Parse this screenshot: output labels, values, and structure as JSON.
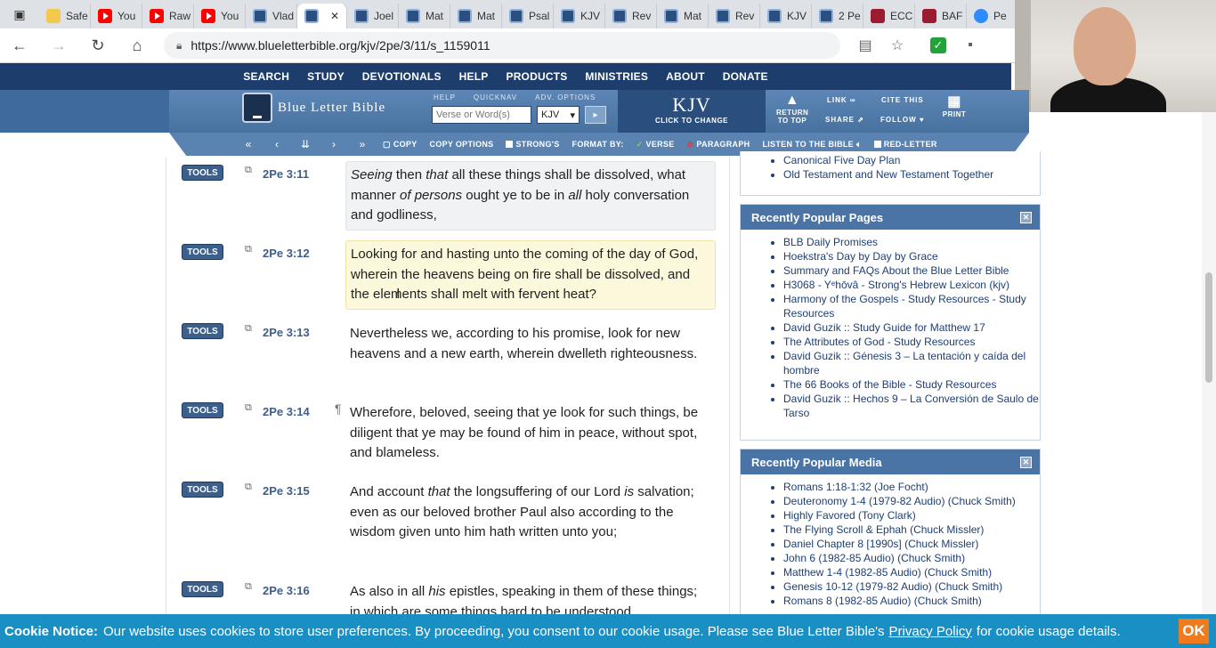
{
  "browser": {
    "tabs": [
      {
        "icon": "check-icon",
        "label": "Safe"
      },
      {
        "icon": "youtube-icon",
        "label": "You"
      },
      {
        "icon": "youtube-icon",
        "label": "Raw"
      },
      {
        "icon": "youtube-icon",
        "label": "You"
      },
      {
        "icon": "blb-icon",
        "label": "Vlad"
      },
      {
        "icon": "blb-icon",
        "label": "",
        "active": true
      },
      {
        "icon": "blb-icon",
        "label": "Joel"
      },
      {
        "icon": "blb-icon",
        "label": "Mat"
      },
      {
        "icon": "blb-icon",
        "label": "Mat"
      },
      {
        "icon": "blb-icon",
        "label": "Psal"
      },
      {
        "icon": "blb-icon",
        "label": "KJV"
      },
      {
        "icon": "blb-icon",
        "label": "Rev"
      },
      {
        "icon": "blb-icon",
        "label": "Mat"
      },
      {
        "icon": "blb-icon",
        "label": "Rev"
      },
      {
        "icon": "blb-icon",
        "label": "KJV"
      },
      {
        "icon": "blb-icon",
        "label": "2 Pe"
      },
      {
        "icon": "red-icon",
        "label": "ECC"
      },
      {
        "icon": "red-icon",
        "label": "BAF"
      },
      {
        "icon": "zoom-icon",
        "label": "Pe"
      }
    ],
    "url": "https://www.blueletterbible.org/kjv/2pe/3/11/s_1159011"
  },
  "site": {
    "topnav": [
      "SEARCH",
      "STUDY",
      "DEVOTIONALS",
      "HELP",
      "PRODUCTS",
      "MINISTRIES",
      "ABOUT",
      "DONATE"
    ],
    "logo_text": "Blue Letter Bible",
    "header_labels": [
      "HELP",
      "QUICKNAV",
      "ADV. OPTIONS"
    ],
    "search_placeholder": "Verse or Word(s)",
    "version": "KJV",
    "version_big": "KJV",
    "version_small": "CLICK TO CHANGE",
    "return_top": "RETURN TO TOP",
    "link": "LINK",
    "share": "SHARE",
    "cite": "CITE THIS",
    "follow": "FOLLOW",
    "print": "PRINT"
  },
  "subnav": {
    "copy": "COPY",
    "copy_options": "COPY OPTIONS",
    "strongs": "STRONG'S",
    "format_by": "FORMAT BY:",
    "verse": "VERSE",
    "paragraph": "PARAGRAPH",
    "listen": "LISTEN TO THE BIBLE",
    "red_letter": "RED-LETTER"
  },
  "verses": [
    {
      "tools": "TOOLS",
      "ref": "2Pe 3:11",
      "html": "<i>Seeing</i> then <i>that</i> all these things shall be dissolved, what manner <i>of persons</i> ought ye to be in <i>all</i> holy conversation and godliness,"
    },
    {
      "tools": "TOOLS",
      "ref": "2Pe 3:12",
      "html": "Looking for and hasting unto the coming of the day of God, wherein the heavens being on fire shall be dissolved, and the elements shall melt with fervent heat?"
    },
    {
      "tools": "TOOLS",
      "ref": "2Pe 3:13",
      "html": "Nevertheless we, according to his promise, look for new heavens and a new earth, wherein dwelleth righteousness."
    },
    {
      "tools": "TOOLS",
      "ref": "2Pe 3:14",
      "html": "Wherefore, beloved, seeing that ye look for such things, be diligent that ye may be found of him in peace, without spot, and blameless."
    },
    {
      "tools": "TOOLS",
      "ref": "2Pe 3:15",
      "html": "And account <i>that</i> the longsuffering of our Lord <i>is</i> salvation; even as our beloved brother Paul also according to the wisdom given unto him hath written unto you;"
    },
    {
      "tools": "TOOLS",
      "ref": "2Pe 3:16",
      "html": "As also in all <i>his</i> epistles, speaking in them of these things; in which are some things hard to be understood,"
    }
  ],
  "paragraph_mark": "¶",
  "sidebar": {
    "top_items": [
      "Canonical Five Day Plan",
      "Old Testament and New Testament Together"
    ],
    "popular_pages": {
      "title": "Recently Popular Pages",
      "items": [
        "BLB Daily Promises",
        "Hoekstra's Day by Day by Grace",
        "Summary and FAQs About the Blue Letter Bible",
        "H3068 - Yᵉhōvâ - Strong's Hebrew Lexicon (kjv)",
        "Harmony of the Gospels - Study Resources - Study Resources",
        "David Guzik :: Study Guide for Matthew 17",
        "The Attributes of God - Study Resources",
        "David Guzik :: Génesis 3 – La tentación y caída del hombre",
        "The 66 Books of the Bible - Study Resources",
        "David Guzik :: Hechos 9 – La Conversión de Saulo de Tarso"
      ]
    },
    "popular_media": {
      "title": "Recently Popular Media",
      "items": [
        "Romans 1:18-1:32 (Joe Focht)",
        "Deuteronomy 1-4 (1979-82 Audio) (Chuck Smith)",
        "Highly Favored (Tony Clark)",
        "The Flying Scroll & Ephah (Chuck Missler)",
        "Daniel Chapter 8 [1990s] (Chuck Missler)",
        "John 6 (1982-85 Audio) (Chuck Smith)",
        "Matthew 1-4 (1982-85 Audio) (Chuck Smith)",
        "Genesis 10-12 (1979-82 Audio) (Chuck Smith)",
        "Romans 8 (1982-85 Audio) (Chuck Smith)"
      ]
    }
  },
  "cookie": {
    "title": "Cookie Notice:",
    "text1": "Our website uses cookies to store user preferences. By proceeding, you consent to our cookie usage. Please see Blue Letter Bible's",
    "link": "Privacy Policy",
    "text2": "for cookie usage details.",
    "ok": "OK"
  },
  "colors": {
    "blb_dark": "#1d3d6c",
    "blb_mid": "#4a74a6",
    "verse_highlight": "#fbf8dc",
    "cookie_bar": "#1a8fc4",
    "cookie_ok": "#f07b1c"
  }
}
